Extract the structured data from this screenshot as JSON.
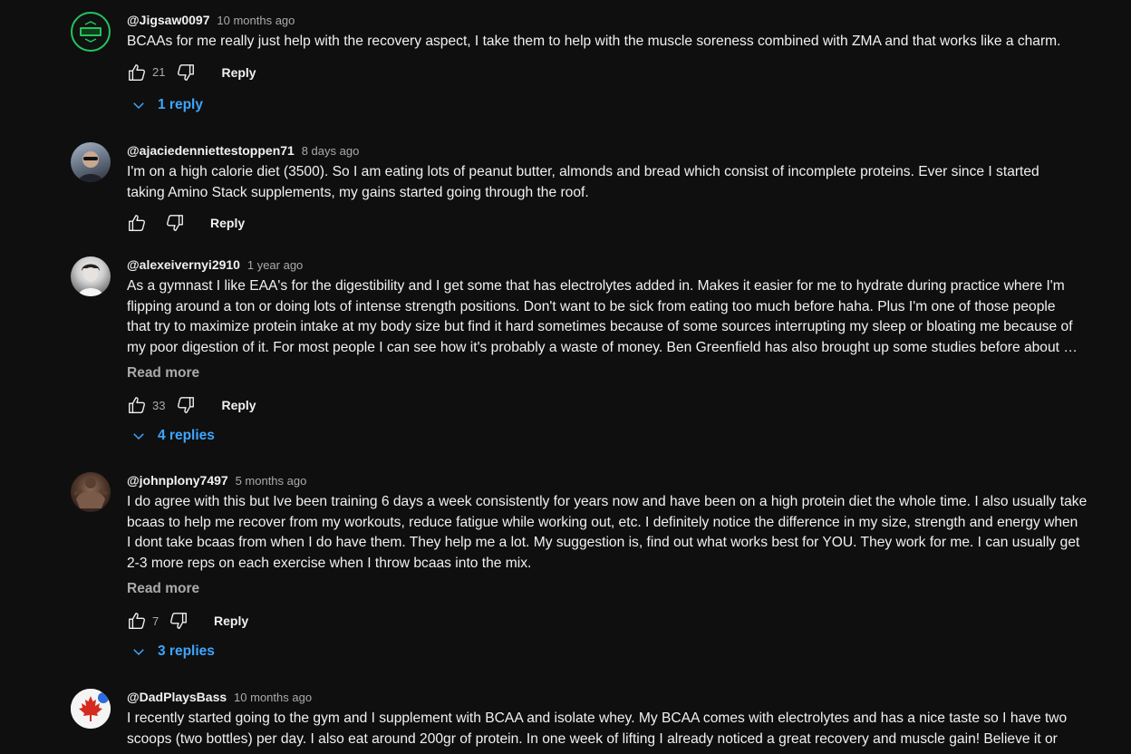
{
  "comments": [
    {
      "author": "@Jigsaw0097",
      "time": "10 months ago",
      "text": "BCAAs for me really just help with the recovery aspect, I take them to help with the muscle soreness combined with ZMA and that works like a charm.",
      "likes": "21",
      "reply_label": "Reply",
      "replies_label": "1 reply",
      "avatar": {
        "icon": "jigsaw-logo-avatar",
        "colors": [
          "#1a1a1a",
          "#22c55e"
        ]
      }
    },
    {
      "author": "@ajaciedenniettestoppen71",
      "time": "8 days ago",
      "text": "I'm on a high calorie diet (3500). So I am eating lots of peanut butter, almonds and bread which consist of incomplete proteins. Ever since I started\ntaking Amino Stack supplements, my gains started going through the roof.",
      "likes": "",
      "reply_label": "Reply",
      "avatar": {
        "icon": "user-photo-avatar",
        "colors": [
          "#9aa7b8",
          "#2b2f36"
        ]
      }
    },
    {
      "author": "@alexeivernyi2910",
      "time": "1 year ago",
      "text": "As a gymnast I like EAA's for the digestibility and I get some that has electrolytes added in. Makes it easier for me to hydrate during practice where I'm\nflipping around a ton or doing lots of intense strength positions. Don't want to be sick from eating too much before haha. Plus I'm one of those people\nthat try to maximize protein intake at my body size but find it hard sometimes because of some sources interrupting my sleep or bloating me because of\nmy poor digestion of it. For most people I can see how it's probably a waste of money. Ben Greenfield has also brought up some studies before about …",
      "read_more": "Read more",
      "likes": "33",
      "reply_label": "Reply",
      "replies_label": "4 replies",
      "avatar": {
        "icon": "user-photo-avatar",
        "colors": [
          "#d9d9d9",
          "#3a3a3a"
        ]
      }
    },
    {
      "author": "@johnplony7497",
      "time": "5 months ago",
      "text": "I do agree with this but Ive been training 6 days a week consistently for years now and have been on a high protein diet the whole time. I also usually take\nbcaas to help me recover from my workouts, reduce fatigue while working out, etc. I definitely notice the difference in my size, strength and energy when\nI dont take bcaas from when I do have them. They help me a lot. My suggestion is, find out what works best for YOU. They work for me. I can usually get\n2-3 more reps on each exercise when I throw bcaas into the mix.",
      "read_more": "Read more",
      "likes": "7",
      "reply_label": "Reply",
      "replies_label": "3 replies",
      "avatar": {
        "icon": "user-photo-avatar",
        "colors": [
          "#3a2a22",
          "#8a6a55"
        ]
      }
    },
    {
      "author": "@DadPlaysBass",
      "time": "10 months ago",
      "text": "I recently started going to the gym and I supplement with BCAA and isolate whey. My BCAA comes with electrolytes and has a nice taste so I have two\nscoops (two bottles) per day. I also eat around 200gr of protein. In one week of lifting I already noticed a great recovery and muscle gain! Believe it or",
      "likes": "",
      "reply_label": "Reply",
      "avatar": {
        "icon": "maple-leaf-avatar",
        "colors": [
          "#ffffff",
          "#d52b1e"
        ]
      }
    }
  ]
}
